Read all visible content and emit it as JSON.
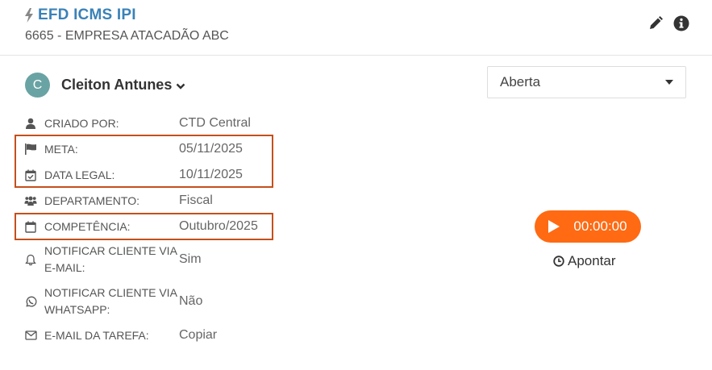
{
  "header": {
    "title": "EFD ICMS IPI",
    "subtitle": "6665 - EMPRESA ATACADÃO ABC",
    "icons": [
      "bolt-icon",
      "pencil-icon",
      "info-icon"
    ]
  },
  "user": {
    "initial": "C",
    "name": "Cleiton Antunes"
  },
  "status": {
    "selected": "Aberta"
  },
  "details": [
    {
      "icon": "user-icon",
      "label": "CRIADO POR:",
      "value": "CTD Central"
    },
    {
      "icon": "flag-icon",
      "label": "META:",
      "value": "05/11/2025"
    },
    {
      "icon": "calendar-check-icon",
      "label": "DATA LEGAL:",
      "value": "10/11/2025"
    },
    {
      "icon": "users-icon",
      "label": "DEPARTAMENTO:",
      "value": "Fiscal"
    },
    {
      "icon": "calendar-icon",
      "label": "COMPETÊNCIA:",
      "value": "Outubro/2025"
    },
    {
      "icon": "bell-icon",
      "label": "NOTIFICAR CLIENTE VIA E-MAIL:",
      "value": "Sim"
    },
    {
      "icon": "whatsapp-icon",
      "label": "NOTIFICAR CLIENTE VIA WHATSAPP:",
      "value": "Não"
    },
    {
      "icon": "envelope-icon",
      "label": "E-MAIL DA TAREFA:",
      "value": "Copiar"
    }
  ],
  "timer": {
    "value": "00:00:00"
  },
  "apontar": {
    "label": "Apontar"
  },
  "colors": {
    "accent": "#ff6a13",
    "title": "#3a82b8",
    "highlight": "#c4501c",
    "avatar": "#6aa3a3"
  }
}
